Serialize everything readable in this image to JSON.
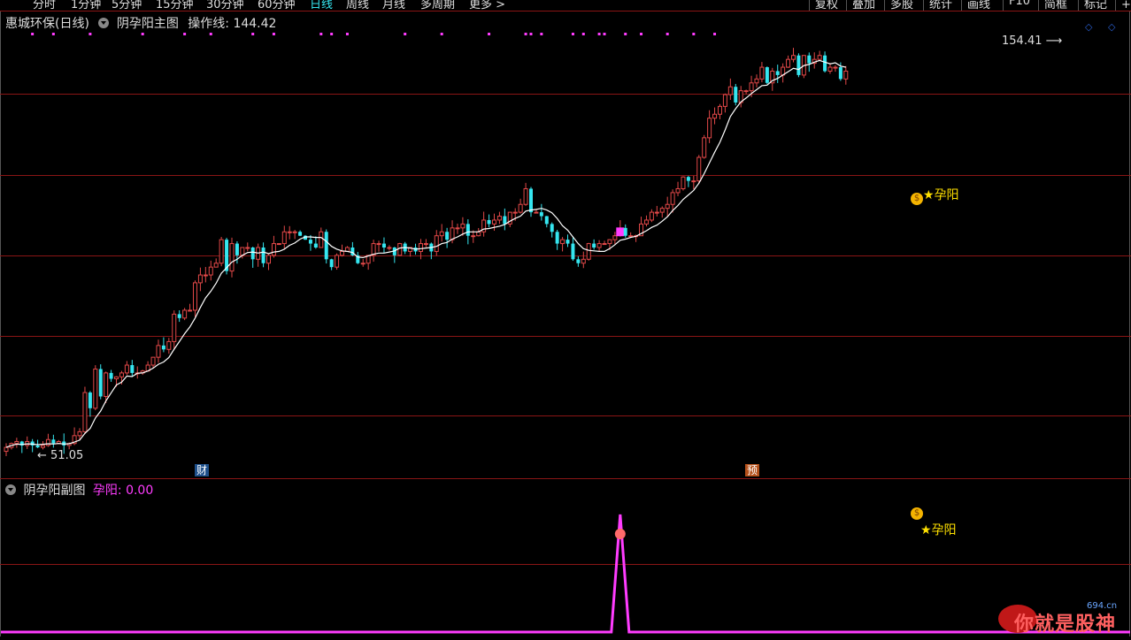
{
  "toolbar": {
    "periods": [
      "分时",
      "1分钟",
      "5分钟",
      "15分钟",
      "30分钟",
      "60分钟",
      "日线",
      "周线",
      "月线",
      "多周期",
      "更多 >"
    ],
    "active_period": "日线",
    "tools": [
      "复权",
      "叠加",
      "多股",
      "统计",
      "画线",
      "F10",
      "简框",
      "标记",
      "+自"
    ]
  },
  "main_panel": {
    "stock_name": "惠城环保(日线)",
    "indicator": "阴孕阳主图",
    "op_line_label": "操作线: 144.42",
    "high_label": "154.41",
    "low_label": "51.05",
    "signal_label": "孕阳",
    "badge_cai": "财",
    "badge_yu": "预",
    "bag_glyph": "$"
  },
  "sub_panel": {
    "title": "阴孕阳副图",
    "value_label": "孕阳: 0.00",
    "signal_label": "孕阳"
  },
  "watermark": {
    "text": "你就是股神",
    "site": "694.cn"
  },
  "chart_data": {
    "type": "candlestick",
    "title": "惠城环保(日线)",
    "y_markers": {
      "high": 154.41,
      "low": 51.05,
      "op_line": 144.42
    },
    "colors": {
      "up": "#e24848",
      "down": "#35e6f0",
      "ma": "#ffffff",
      "signal": "#ff3cff",
      "grid": "#8a1515"
    },
    "signal_dots": [
      5,
      9,
      16,
      26,
      34,
      39,
      47,
      51,
      60,
      62,
      65,
      76,
      83,
      92,
      99,
      100,
      102,
      108,
      110,
      113,
      114,
      118,
      121,
      126,
      131,
      135
    ],
    "sub_series": {
      "name": "孕阳",
      "spike_index": 117,
      "spike_value": 1,
      "current": 0.0
    },
    "close": [
      52,
      53,
      53.5,
      52.5,
      53.5,
      52.5,
      52,
      52.5,
      54,
      53,
      53.5,
      52.5,
      53,
      55,
      56,
      66,
      62,
      72,
      65,
      71,
      69.5,
      70,
      71,
      73,
      71,
      71,
      71.5,
      73,
      75,
      78,
      77,
      79,
      86,
      85,
      87,
      87,
      94,
      96,
      96,
      98,
      99,
      105,
      97,
      104,
      101,
      103,
      103,
      100,
      103,
      99,
      101,
      104,
      104,
      107,
      107,
      107,
      106,
      105,
      104,
      103,
      107,
      100,
      98,
      101,
      102,
      103,
      101,
      99,
      99,
      101,
      104,
      104,
      103,
      103,
      101,
      104,
      102,
      103,
      102,
      104,
      104,
      102,
      106,
      107,
      105,
      108,
      108,
      109,
      106,
      106,
      107,
      110,
      109,
      110,
      111,
      109,
      112,
      112,
      114,
      118,
      112,
      112,
      111,
      109,
      107,
      104,
      105,
      104,
      100,
      99,
      100,
      104,
      103,
      104,
      104,
      105,
      106,
      108,
      106,
      106,
      106,
      109,
      110,
      112,
      112,
      113,
      114,
      117,
      118,
      121,
      120,
      120,
      126,
      131,
      136,
      137,
      139,
      142,
      144,
      140,
      143,
      143,
      145,
      146,
      149,
      145,
      148,
      147,
      149,
      151,
      152,
      147,
      152,
      150,
      151,
      152,
      148,
      149,
      149,
      146,
      148
    ]
  }
}
